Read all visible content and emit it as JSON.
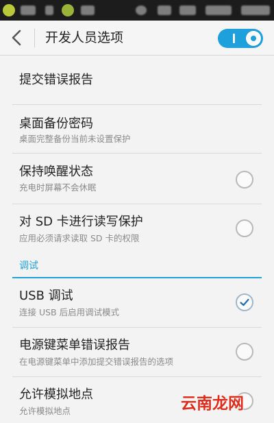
{
  "header": {
    "title": "开发人员选项",
    "back_icon": "back-chevron-icon",
    "master_switch_on": true
  },
  "rows": [
    {
      "title": "提交错误报告"
    },
    {
      "title": "桌面备份密码",
      "subtitle": "桌面完整备份当前未设置保护"
    },
    {
      "title": "保持唤醒状态",
      "subtitle": "充电时屏幕不会休眠",
      "checked": false
    },
    {
      "title": "对 SD 卡进行读写保护",
      "subtitle": "应用必须请求读取 SD 卡的权限",
      "checked": false
    }
  ],
  "debug_section": {
    "title": "调试",
    "rows": [
      {
        "title": "USB 调试",
        "subtitle": "连接 USB 后启用调试模式",
        "checked": true
      },
      {
        "title": "电源键菜单错误报告",
        "subtitle": "在电源键菜单中添加提交错误报告的选项",
        "checked": false
      },
      {
        "title": "允许模拟地点",
        "subtitle": "允许模拟地点",
        "checked": false
      }
    ]
  },
  "watermark": "云南龙网",
  "colors": {
    "accent": "#1ea0dc",
    "watermark": "#e02a1a"
  }
}
